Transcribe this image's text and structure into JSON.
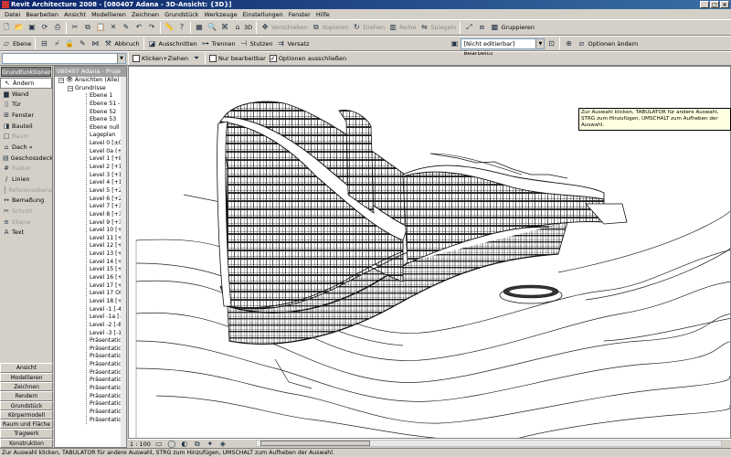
{
  "window": {
    "title": "Revit Architecture 2008 - [080407 Adana - 3D-Ansicht: {3D}]"
  },
  "menu": [
    "Datei",
    "Bearbeiten",
    "Ansicht",
    "Modellieren",
    "Zeichnen",
    "Grundstück",
    "Werkzeuge",
    "Einstellungen",
    "Fenster",
    "Hilfe"
  ],
  "toolbar1": {
    "zoom_label": "3D",
    "disabled_labels": [
      "Verschieben",
      "Kopieren",
      "Drehen",
      "Reihe",
      "Spiegeln"
    ],
    "group_label": "Gruppieren"
  },
  "toolbar2": {
    "ebene_label": "Ebene",
    "abbruch_label": "Abbruch",
    "ausschnitten_label": "Ausschnitten",
    "trennen_label": "Trennen",
    "stutzen_label": "Stutzen",
    "versatz_label": "Versatz",
    "workset_value": "[Nicht editierbar] Bearbeitu",
    "optionen_label": "Optionen ändern"
  },
  "toolbar3": {
    "klicken_label": "Klicken+Ziehen",
    "nur_label": "Nur bearbeitbar",
    "optionen_label": "Optionen ausschließen"
  },
  "design_bar": {
    "header": "Grundfunktionen",
    "tools": [
      {
        "label": "Ändern",
        "icon": "↖",
        "state": "active"
      },
      {
        "label": "Wand",
        "icon": "▆",
        "state": "normal"
      },
      {
        "label": "Tür",
        "icon": "▯",
        "state": "normal"
      },
      {
        "label": "Fenster",
        "icon": "⊞",
        "state": "normal"
      },
      {
        "label": "Bauteil",
        "icon": "◨",
        "state": "normal"
      },
      {
        "label": "Raum",
        "icon": "□",
        "state": "disabled"
      },
      {
        "label": "Dach »",
        "icon": "⌂",
        "state": "normal"
      },
      {
        "label": "Geschossdecke",
        "icon": "▤",
        "state": "normal"
      },
      {
        "label": "Raster",
        "icon": "#",
        "state": "disabled"
      },
      {
        "label": "Linien",
        "icon": "/",
        "state": "normal"
      },
      {
        "label": "Referenzebene",
        "icon": "┆",
        "state": "disabled"
      },
      {
        "label": "Bemaßung",
        "icon": "↔",
        "state": "normal"
      },
      {
        "label": "Schnitt",
        "icon": "✂",
        "state": "disabled"
      },
      {
        "label": "Ebene",
        "icon": "≡",
        "state": "disabled"
      },
      {
        "label": "Text",
        "icon": "A",
        "state": "normal"
      }
    ],
    "tabs": [
      "Ansicht",
      "Modellieren",
      "Zeichnen",
      "Rendern",
      "Grundstück",
      "Körpermodell",
      "Raum und Fläche",
      "Tragwerk",
      "Konstruktion"
    ]
  },
  "browser": {
    "title": "080407 Adana - Proje",
    "root": "Ansichten (Alle)",
    "group": "Grundrisse",
    "items": [
      "Ebene 1",
      "Ebene 51 - S",
      "Ebene 52",
      "Ebene 53",
      "Ebene null",
      "Lageplan",
      "Level 0 [±0.0",
      "Level 0a (+4",
      "Level 1 [+8.0",
      "Level 2 [+12",
      "Level 3 [+16",
      "Level 4 [+19",
      "Level 5 [+23",
      "Level 6 [+26",
      "Level 7 [+30",
      "Level 8 [+34",
      "Level 9 [+37",
      "Level 10 [+4",
      "Level 11 [+4",
      "Level 12 [+4",
      "Level 13 [+5",
      "Level 14 [+5",
      "Level 15 [+5",
      "Level 16 [+6",
      "Level 17 [+6",
      "Level 17 OK",
      "Level 18 [+7",
      "Level -1 [-4.5",
      "Level -1a [-8",
      "Level -2 [-8.5",
      "Level -3 [-11",
      "Präsentation",
      "Präsentation",
      "Präsentation",
      "Präsentation",
      "Präsentation",
      "Präsentation",
      "Präsentation",
      "Präsentation",
      "Präsentation",
      "Präsentation",
      "Präsentation"
    ]
  },
  "tooltip": "Zur Auswahl klicken, TABULATOR für andere Auswahl, STRG zum Hinzufügen, UMSCHALT zum Aufheben der Auswahl.",
  "view_control": {
    "scale": "1 : 100"
  },
  "status_text": "Zur Auswahl klicken, TABULATOR für andere Auswahl, STRG zum Hinzufügen, UMSCHALT zum Aufheben der Auswahl."
}
